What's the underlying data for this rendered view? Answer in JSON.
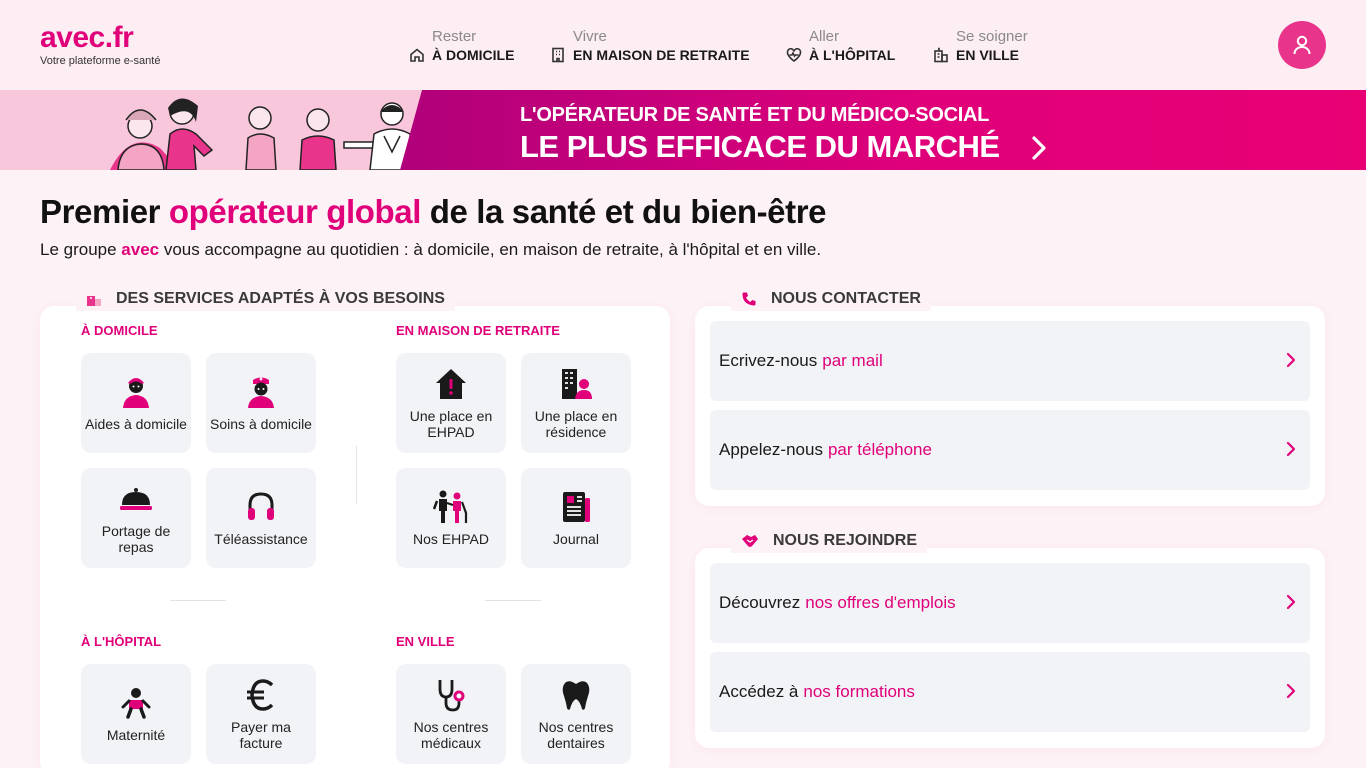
{
  "header": {
    "logo": "avec.fr",
    "tagline": "Votre plateforme e-santé",
    "nav": [
      {
        "sub": "Rester",
        "main": "À DOMICILE",
        "icon": "home-icon"
      },
      {
        "sub": "Vivre",
        "main": "EN MAISON DE RETRAITE",
        "icon": "building-icon"
      },
      {
        "sub": "Aller",
        "main": "À L'HÔPITAL",
        "icon": "heart-pulse-icon"
      },
      {
        "sub": "Se soigner",
        "main": "EN VILLE",
        "icon": "city-icon"
      }
    ],
    "user_icon": "user-icon"
  },
  "banner": {
    "line1": "L'OPÉRATEUR DE SANTÉ ET DU MÉDICO-SOCIAL",
    "line2": "LE PLUS EFFICACE DU MARCHÉ"
  },
  "hero": {
    "title_before": "Premier ",
    "title_highlight": "opérateur global",
    "title_after": " de la santé et du bien-être",
    "intro_before": "Le groupe ",
    "intro_highlight": "avec",
    "intro_after": " vous accompagne au quotidien : à domicile, en maison de retraite, à l'hôpital et en ville."
  },
  "services": {
    "title": "DES SERVICES ADAPTÉS À VOS BESOINS",
    "categories": [
      {
        "label": "À DOMICILE",
        "tiles": [
          {
            "label": "Aides à domicile",
            "icon": "caregiver-icon"
          },
          {
            "label": "Soins à domicile",
            "icon": "nurse-icon"
          },
          {
            "label": "Portage de repas",
            "icon": "meal-cloche-icon"
          },
          {
            "label": "Téléassistance",
            "icon": "headset-icon"
          }
        ]
      },
      {
        "label": "EN MAISON DE RETRAITE",
        "tiles": [
          {
            "label": "Une place en EHPAD",
            "icon": "house-alert-icon"
          },
          {
            "label": "Une place en résidence",
            "icon": "residence-icon"
          },
          {
            "label": "Nos EHPAD",
            "icon": "people-icon"
          },
          {
            "label": "Journal",
            "icon": "newspaper-icon"
          }
        ]
      },
      {
        "label": "À L'HÔPITAL",
        "tiles": [
          {
            "label": "Maternité",
            "icon": "baby-icon"
          },
          {
            "label": "Payer ma facture",
            "icon": "euro-icon"
          }
        ]
      },
      {
        "label": "EN VILLE",
        "tiles": [
          {
            "label": "Nos centres médicaux",
            "icon": "stethoscope-icon"
          },
          {
            "label": "Nos centres dentaires",
            "icon": "tooth-icon"
          }
        ]
      }
    ]
  },
  "contact": {
    "title": "NOUS CONTACTER",
    "rows": [
      {
        "text": "Ecrivez-nous",
        "highlight": "par mail"
      },
      {
        "text": "Appelez-nous",
        "highlight": "par téléphone"
      }
    ]
  },
  "join": {
    "title": "NOUS REJOINDRE",
    "rows": [
      {
        "text": "Découvrez",
        "highlight": "nos offres d'emplois"
      },
      {
        "text": "Accédez à",
        "highlight": "nos formations"
      }
    ]
  },
  "colors": {
    "brand": "#e0007a",
    "tile_bg": "#f2f3f7",
    "header_bg": "#fdeef3"
  }
}
